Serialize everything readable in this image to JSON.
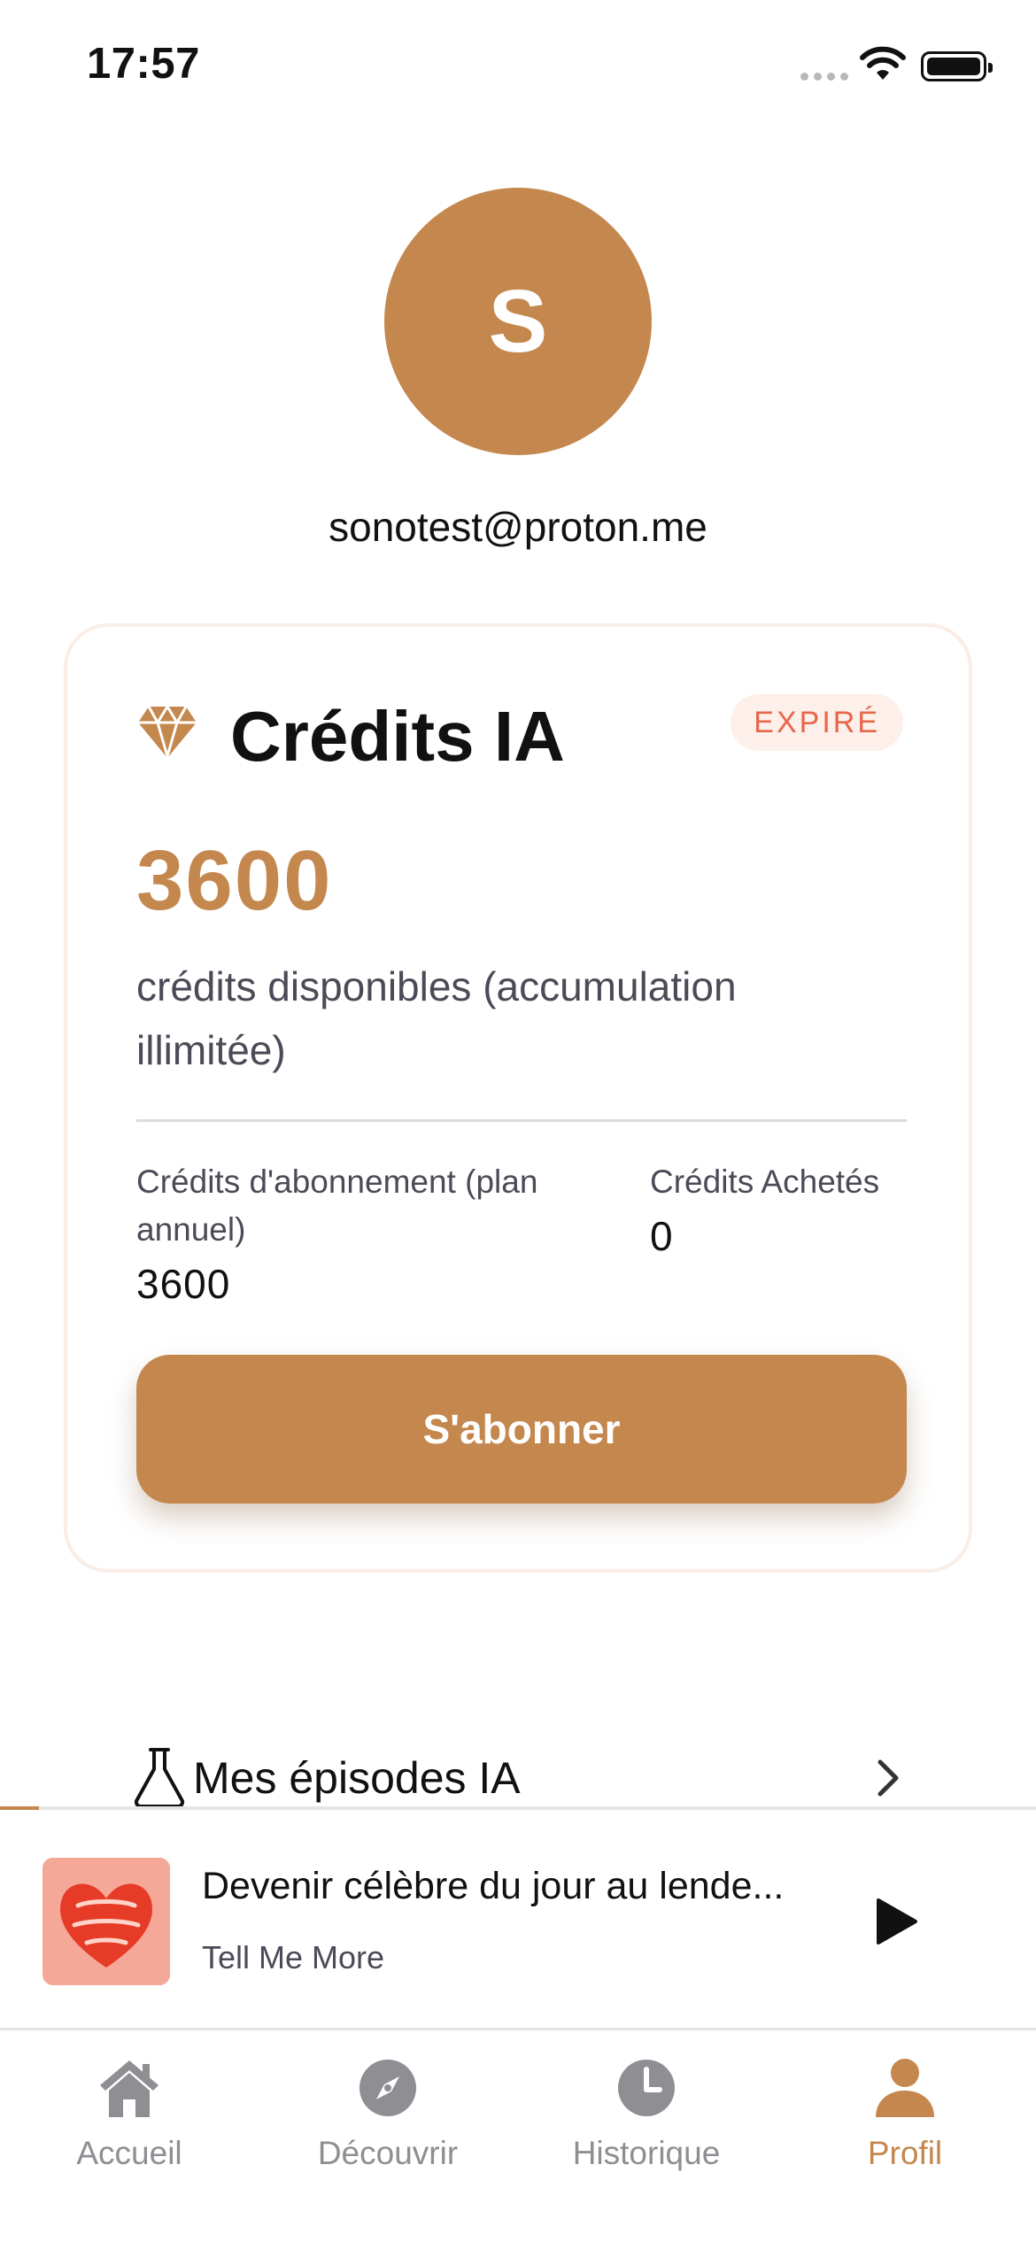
{
  "status_bar": {
    "time": "17:57"
  },
  "profile": {
    "initial": "S",
    "email": "sonotest@proton.me"
  },
  "credits_card": {
    "title": "Crédits IA",
    "badge": "EXPIRÉ",
    "total": "3600",
    "description": "crédits disponibles (accumulation illimitée)",
    "subscription_label": "Crédits d'abonnement (plan annuel)",
    "subscription_value": "3600",
    "purchased_label": "Crédits Achetés",
    "purchased_value": "0",
    "subscribe_button": "S'abonner"
  },
  "menu": {
    "ai_episodes": "Mes épisodes IA"
  },
  "mini_player": {
    "episode_title": "Devenir célèbre du jour au lende...",
    "show": "Tell Me More"
  },
  "tabs": [
    {
      "label": "Accueil",
      "icon": "home-icon"
    },
    {
      "label": "Découvrir",
      "icon": "compass-icon"
    },
    {
      "label": "Historique",
      "icon": "clock-icon"
    },
    {
      "label": "Profil",
      "icon": "person-icon",
      "active": true
    }
  ],
  "colors": {
    "accent": "#c4874d",
    "badge_text": "#e8664a",
    "badge_bg": "#fdefe9",
    "inactive_tab": "#8e8e93"
  }
}
